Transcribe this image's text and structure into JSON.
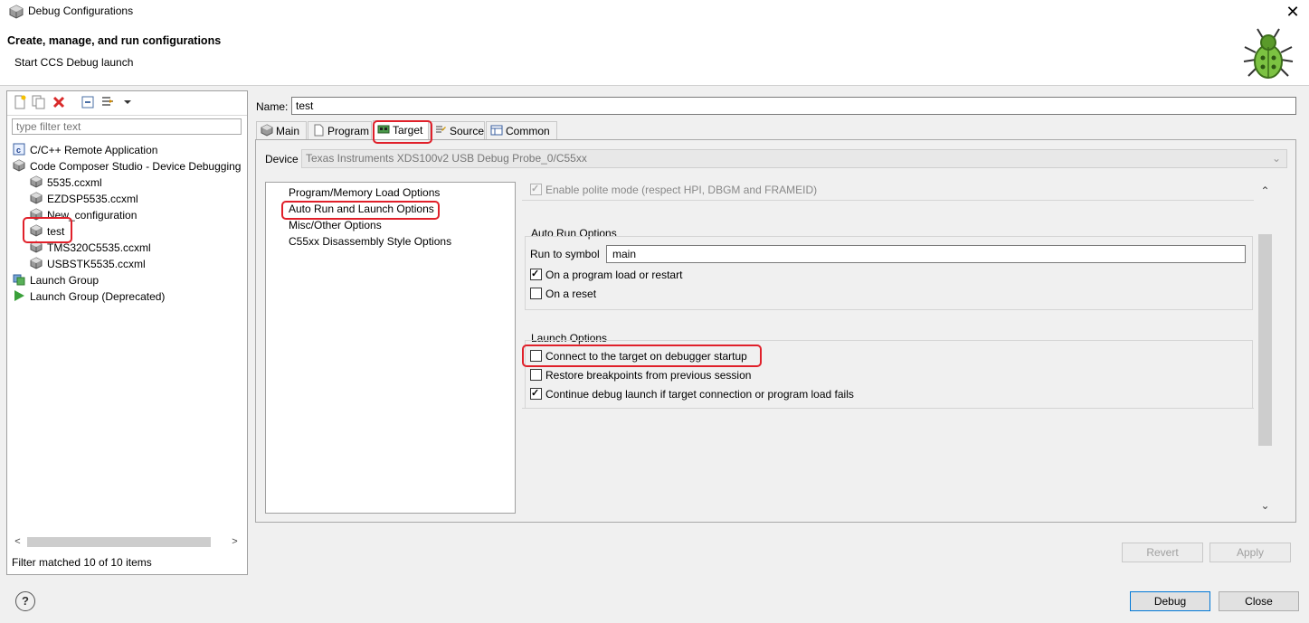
{
  "window": {
    "title": "Debug Configurations",
    "close_glyph": "✕"
  },
  "banner": {
    "title": "Create, manage, and run configurations",
    "subtitle": "Start CCS Debug launch"
  },
  "left": {
    "filter_placeholder": "type filter text",
    "tree": [
      {
        "label": "C/C++ Remote Application",
        "icon": "c-app-icon",
        "indent": 0
      },
      {
        "label": "Code Composer Studio - Device Debugging",
        "icon": "ccs-cube-icon",
        "indent": 0
      },
      {
        "label": "5535.ccxml",
        "icon": "ccs-cube-icon",
        "indent": 1
      },
      {
        "label": "EZDSP5535.ccxml",
        "icon": "ccs-cube-icon",
        "indent": 1
      },
      {
        "label": "New_configuration",
        "icon": "ccs-cube-icon",
        "indent": 1
      },
      {
        "label": "test",
        "icon": "ccs-cube-icon",
        "indent": 1
      },
      {
        "label": "TMS320C5535.ccxml",
        "icon": "ccs-cube-icon",
        "indent": 1
      },
      {
        "label": "USBSTK5535.ccxml",
        "icon": "ccs-cube-icon",
        "indent": 1
      },
      {
        "label": "Launch Group",
        "icon": "launch-group-icon",
        "indent": 0
      },
      {
        "label": "Launch Group (Deprecated)",
        "icon": "launch-arrow-icon",
        "indent": 0
      }
    ],
    "status": "Filter matched 10 of 10 items"
  },
  "config": {
    "name_label": "Name:",
    "name_value": "test",
    "tabs": [
      {
        "label": "Main",
        "icon": "cube-icon"
      },
      {
        "label": "Program",
        "icon": "page-icon"
      },
      {
        "label": "Target",
        "icon": "board-icon"
      },
      {
        "label": "Source",
        "icon": "source-icon"
      },
      {
        "label": "Common",
        "icon": "table-icon"
      }
    ],
    "selected_tab": "Target",
    "device_label": "Device",
    "device_value": "Texas Instruments XDS100v2 USB Debug Probe_0/C55xx",
    "options": [
      "Program/Memory Load Options",
      "Auto Run and Launch Options",
      "Misc/Other Options",
      "C55xx Disassembly Style Options"
    ],
    "polite_mode": "Enable polite mode (respect HPI, DBGM and FRAMEID)",
    "auto_run": {
      "title": "Auto Run Options",
      "run_to_label": "Run to symbol",
      "run_to_value": "main",
      "on_load": "On a program load or restart",
      "on_reset": "On a reset"
    },
    "launch": {
      "title": "Launch Options",
      "connect": "Connect to the target on debugger startup",
      "restore": "Restore breakpoints from previous session",
      "continue": "Continue debug launch if target connection or program load fails"
    }
  },
  "buttons": {
    "revert": "Revert",
    "apply": "Apply",
    "debug": "Debug",
    "close": "Close"
  },
  "help": "?"
}
